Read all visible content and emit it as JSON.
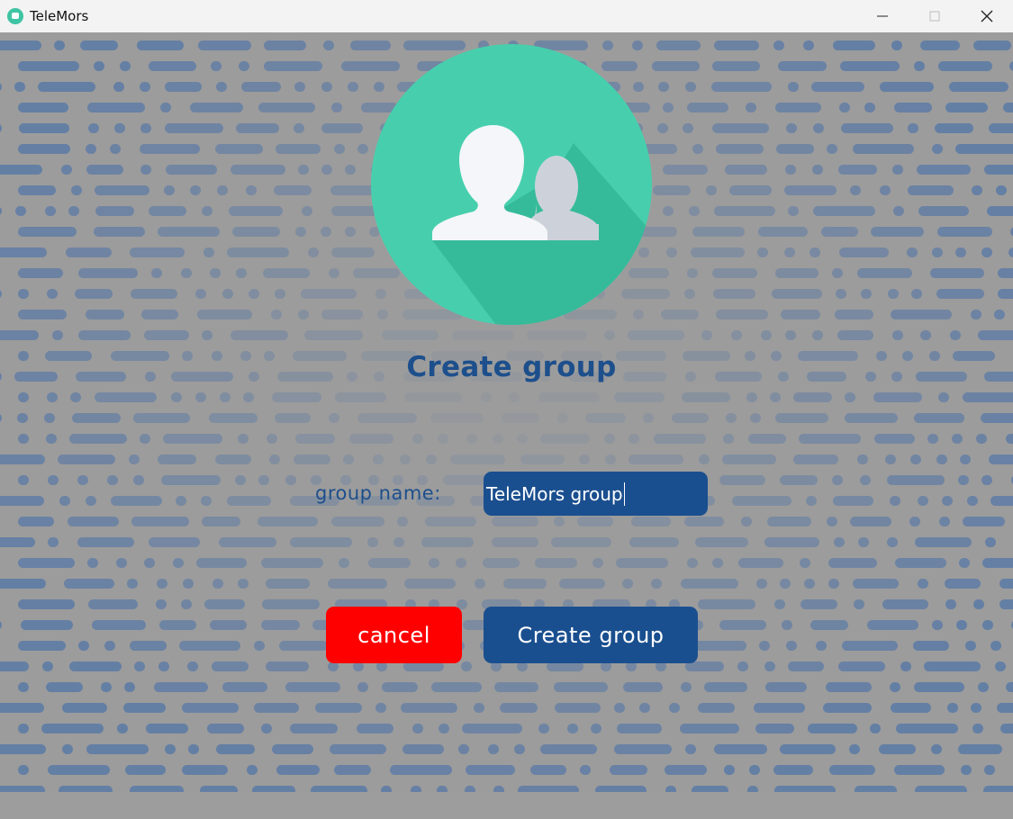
{
  "window": {
    "title": "TeleMors",
    "controls": [
      "minimize-icon",
      "maximize-icon",
      "close-icon"
    ]
  },
  "dialog": {
    "title": "Create group",
    "field_label": "group name:",
    "group_name_value": "TeleMors group",
    "cancel_label": "cancel",
    "create_label": "Create group"
  },
  "colors": {
    "brand_teal": "#47cfad",
    "primary_blue": "#1a4f8f",
    "cancel_red": "#ff0000",
    "pattern_blue": "#5b7aa6"
  }
}
